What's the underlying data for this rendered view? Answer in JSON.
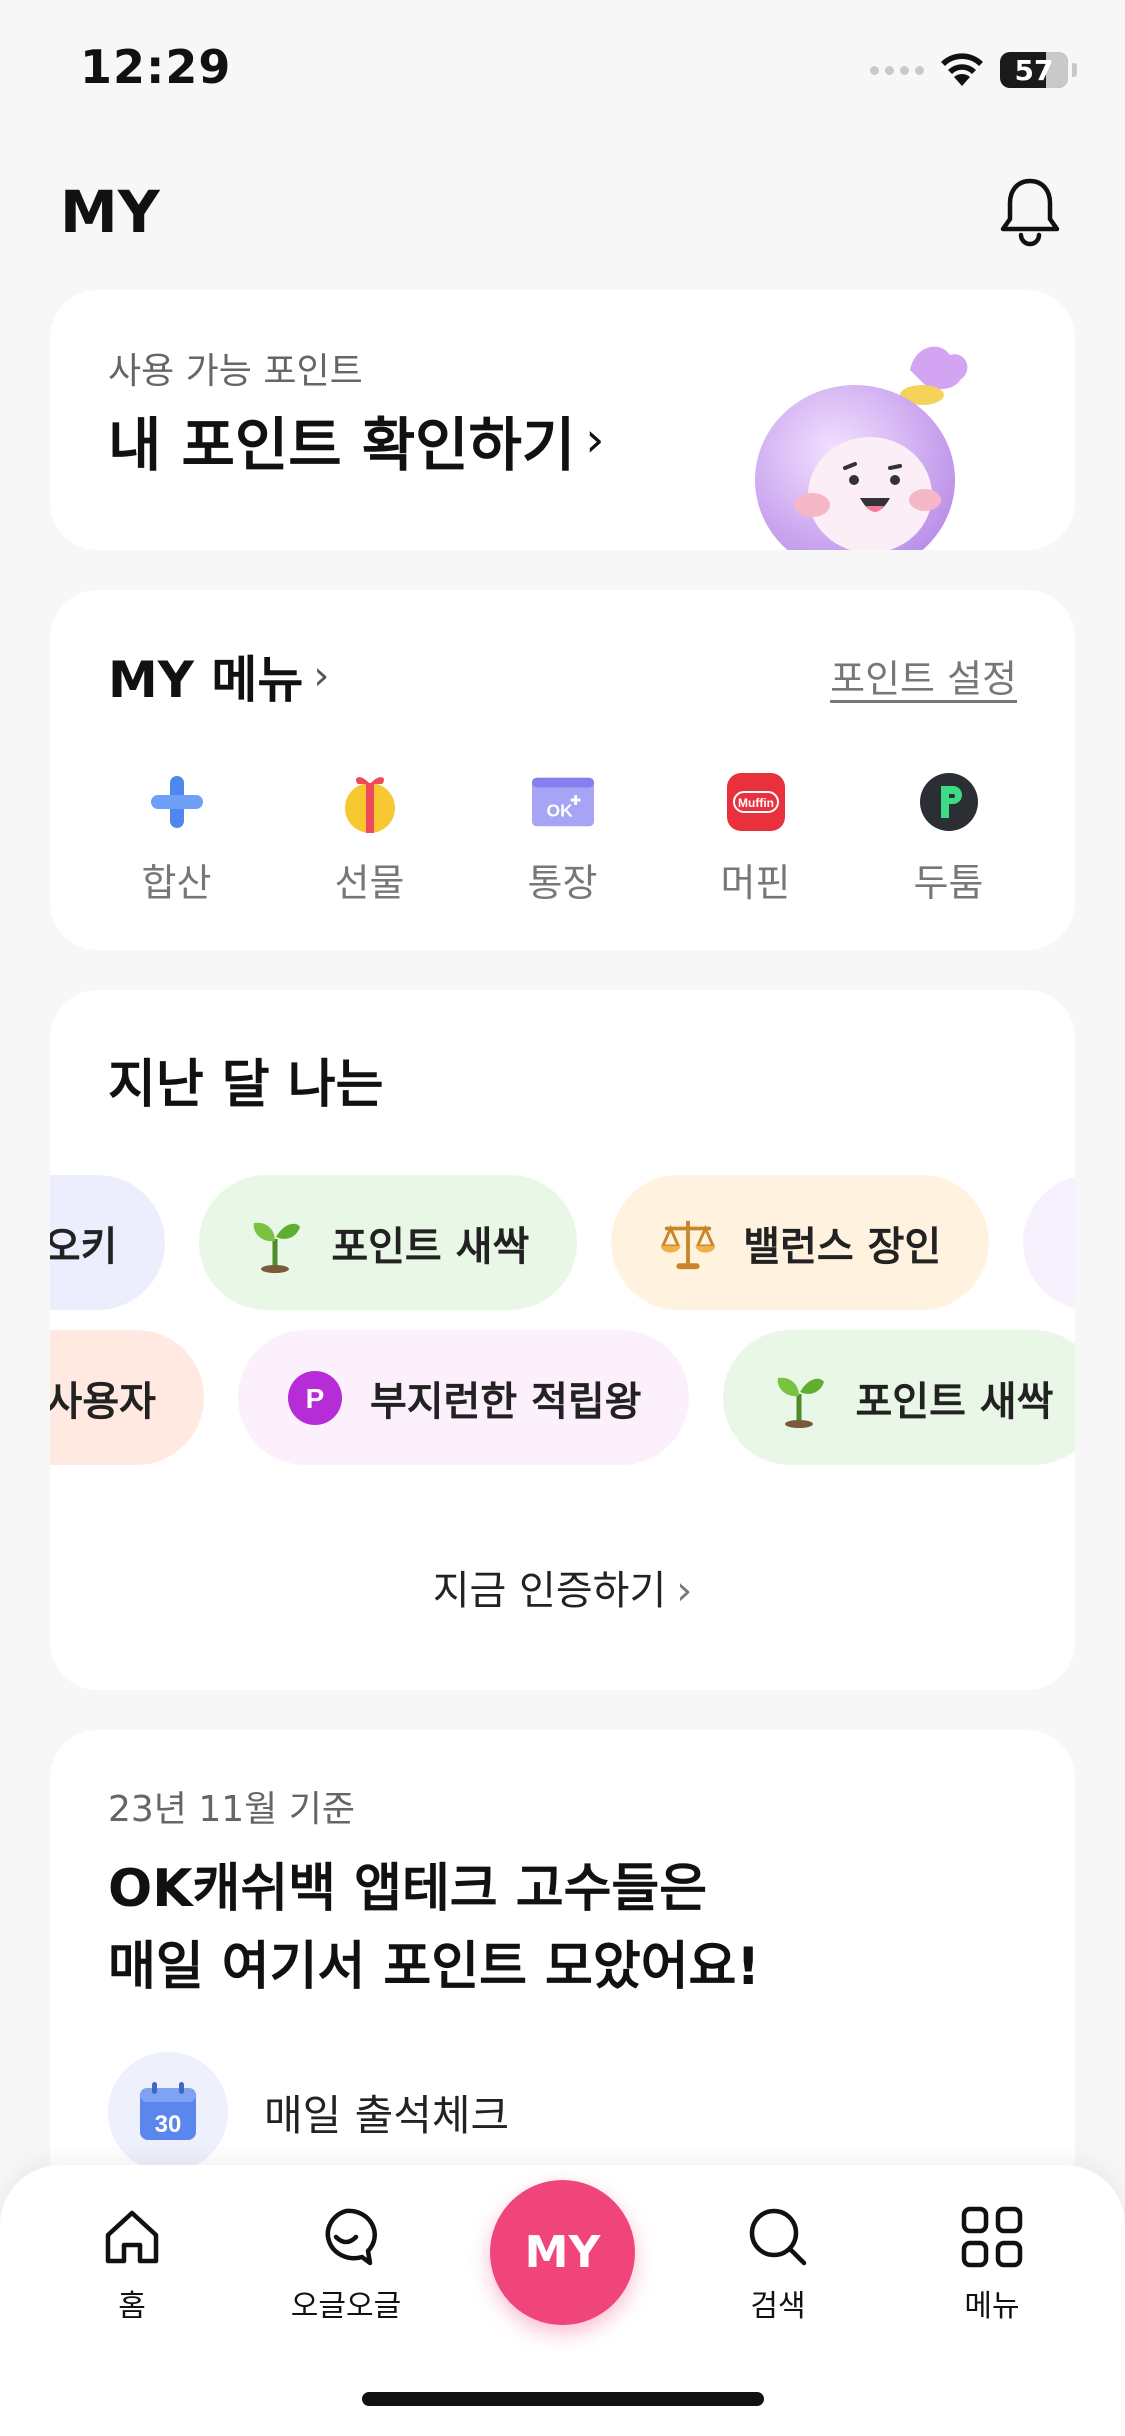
{
  "status_bar": {
    "time": "12:29",
    "battery": "57"
  },
  "header": {
    "title": "MY"
  },
  "points_card": {
    "subtitle": "사용 가능 포인트",
    "title": "내 포인트 확인하기",
    "chevron": "›"
  },
  "my_menu": {
    "title": "MY 메뉴",
    "chevron": "›",
    "settings_link": "포인트 설정",
    "items": [
      {
        "label": "합산",
        "icon": "plus-icon"
      },
      {
        "label": "선물",
        "icon": "gift-icon"
      },
      {
        "label": "통장",
        "icon": "bankbook-icon"
      },
      {
        "label": "머핀",
        "icon": "muffin-icon"
      },
      {
        "label": "두툼",
        "icon": "dootum-icon"
      }
    ],
    "muffin_logo_text": "Muffin",
    "ok_logo_text": "OK"
  },
  "last_month": {
    "title": "지난 달 나는",
    "badges_row1": [
      {
        "label": "컴 오키",
        "icon": ""
      },
      {
        "label": "포인트 새싹",
        "icon": "sprout-icon"
      },
      {
        "label": "밸런스 장인",
        "icon": "scale-icon"
      }
    ],
    "badges_row2": [
      {
        "label": "불꽃 사용자",
        "icon": ""
      },
      {
        "label": "부지런한 적립왕",
        "icon": "point-p-icon"
      },
      {
        "label": "포인트 새싹",
        "icon": "sprout-icon"
      }
    ],
    "p_letter": "P",
    "certify_label": "지금 인증하기",
    "certify_chevron": "›"
  },
  "tip_card": {
    "date": "23년 11월 기준",
    "title_line1": "OK캐쉬백 앱테크 고수들은",
    "title_line2": "매일 여기서 포인트 모았어요!",
    "item_label": "매일 출석체크",
    "calendar_number": "30"
  },
  "tabbar": {
    "home": "홈",
    "ogeul": "오글오글",
    "my": "MY",
    "search": "검색",
    "menu": "메뉴"
  },
  "colors": {
    "accent": "#f0457a",
    "background": "#f7f7f8",
    "sprout_badge": "#e9f8e6",
    "balance_badge": "#fff3e0",
    "point_badge": "#fbf0fb",
    "fire_badge": "#ffe9e0",
    "okki_badge": "#eceefe"
  }
}
